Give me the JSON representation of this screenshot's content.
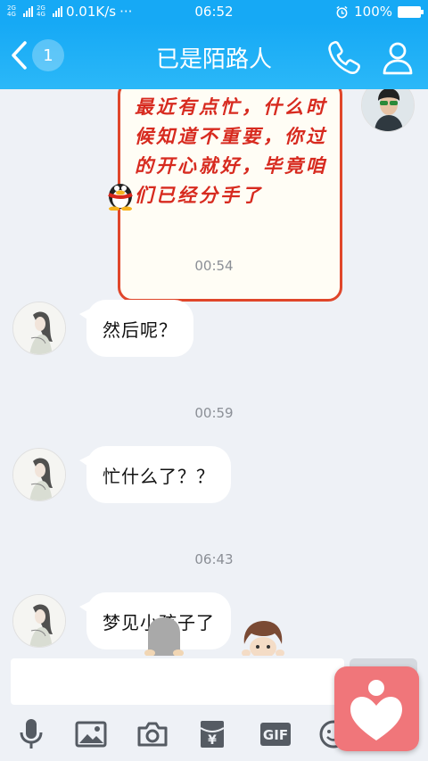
{
  "status_bar": {
    "network_speed": "0.01K/s",
    "dots": "···",
    "time": "06:52",
    "battery": "100%",
    "battery_level": 1.0,
    "tags": [
      "2G",
      "4G",
      "2G",
      "4G"
    ]
  },
  "header": {
    "back_count": "1",
    "title": "已是陌路人"
  },
  "messages": [
    {
      "type": "sticker",
      "side": "right",
      "text": "最近有点忙，什么时候知道不重要，你过的开心就好，毕竟咱们已经分手了"
    },
    {
      "type": "time",
      "text": "00:54"
    },
    {
      "type": "text",
      "side": "left",
      "text": "然后呢？"
    },
    {
      "type": "time",
      "text": "00:59"
    },
    {
      "type": "text",
      "side": "left",
      "text": "忙什么了？？"
    },
    {
      "type": "time",
      "text": "06:43"
    },
    {
      "type": "text",
      "side": "left",
      "text": "梦见小孩子了"
    }
  ],
  "input": {
    "value": "",
    "placeholder": ""
  },
  "toolbar": {
    "items": [
      "microphone-icon",
      "image-icon",
      "camera-icon",
      "red-packet-icon",
      "gif-icon",
      "emoji-icon"
    ],
    "gif_label": "GIF",
    "red_packet_symbol": "¥"
  },
  "colors": {
    "header": "#16a9f5",
    "sticker_text": "#d72a1f",
    "float_badge": "#f0767a"
  }
}
